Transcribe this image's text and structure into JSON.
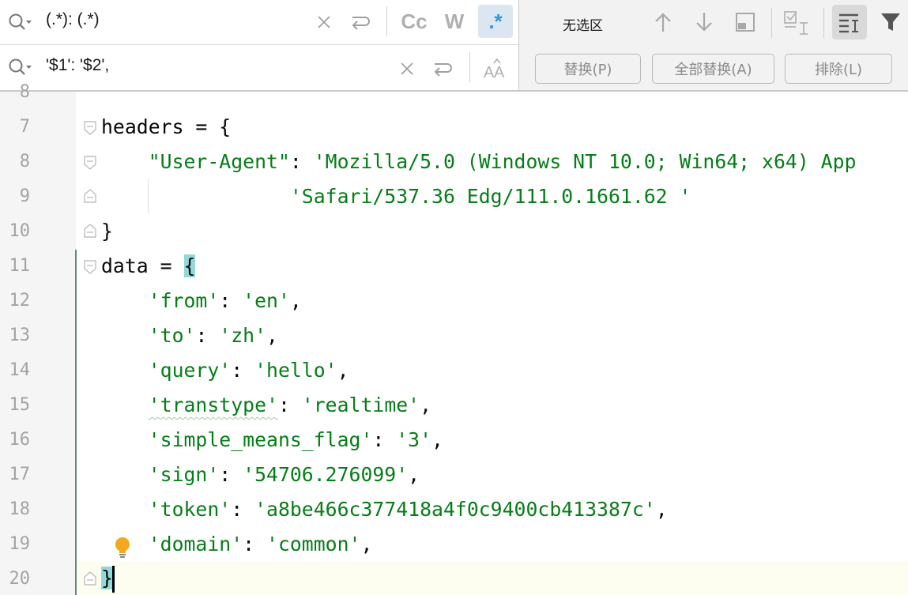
{
  "find": {
    "query": "(.*): (.*)",
    "toggles": [
      {
        "label": "Cc",
        "active": false
      },
      {
        "label": "W",
        "active": false
      },
      {
        "label": ".*",
        "active": true
      }
    ]
  },
  "replace": {
    "value": "'$1': '$2',"
  },
  "selection": {
    "label": "无选区"
  },
  "buttons": {
    "replace": "替换(P)",
    "replace_all": "全部替换(A)",
    "exclude": "排除(L)"
  },
  "editor": {
    "lines": [
      {
        "n": "8"
      },
      {
        "n": "7"
      },
      {
        "n": "8"
      },
      {
        "n": "9"
      },
      {
        "n": "10"
      },
      {
        "n": "11"
      },
      {
        "n": "12"
      },
      {
        "n": "13"
      },
      {
        "n": "14"
      },
      {
        "n": "15"
      },
      {
        "n": "16"
      },
      {
        "n": "17"
      },
      {
        "n": "18"
      },
      {
        "n": "19"
      },
      {
        "n": "20"
      }
    ],
    "code": {
      "l7": "headers = {",
      "l8_key": "\"User-Agent\"",
      "l8_colon": ": ",
      "l8_val": "'Mozilla/5.0 (Windows NT 10.0; Win64; x64) App",
      "l9_val": "'Safari/537.36 Edg/111.0.1661.62 '",
      "l10": "}",
      "l11_a": "data = ",
      "l11_b": "{",
      "pairs": [
        {
          "k": "'from'",
          "v": "'en'",
          "end": ","
        },
        {
          "k": "'to'",
          "v": "'zh'",
          "end": ","
        },
        {
          "k": "'query'",
          "v": "'hello'",
          "end": ","
        },
        {
          "k": "'transtype'",
          "v": "'realtime'",
          "end": ","
        },
        {
          "k": "'simple_means_flag'",
          "v": "'3'",
          "end": ","
        },
        {
          "k": "'sign'",
          "v": "'54706.276099'",
          "end": ","
        },
        {
          "k": "'token'",
          "v": "'a8be466c377418a4f0c9400cb413387c'",
          "end": ","
        },
        {
          "k": "'domain'",
          "v": "'common'",
          "end": ","
        }
      ],
      "sep": ": ",
      "l20": "}"
    }
  },
  "colors": {
    "string": "#067d17",
    "active_toggle": "#2f95dc",
    "brace_highlight": "#93d9d9"
  },
  "icons": [
    "search-icon",
    "clear-icon",
    "newline-icon",
    "arrow-up-icon",
    "arrow-down-icon",
    "window-icon",
    "select-occurrence-icon",
    "filter-lines-icon",
    "filter-icon",
    "preserve-case-icon",
    "lightbulb-icon"
  ]
}
